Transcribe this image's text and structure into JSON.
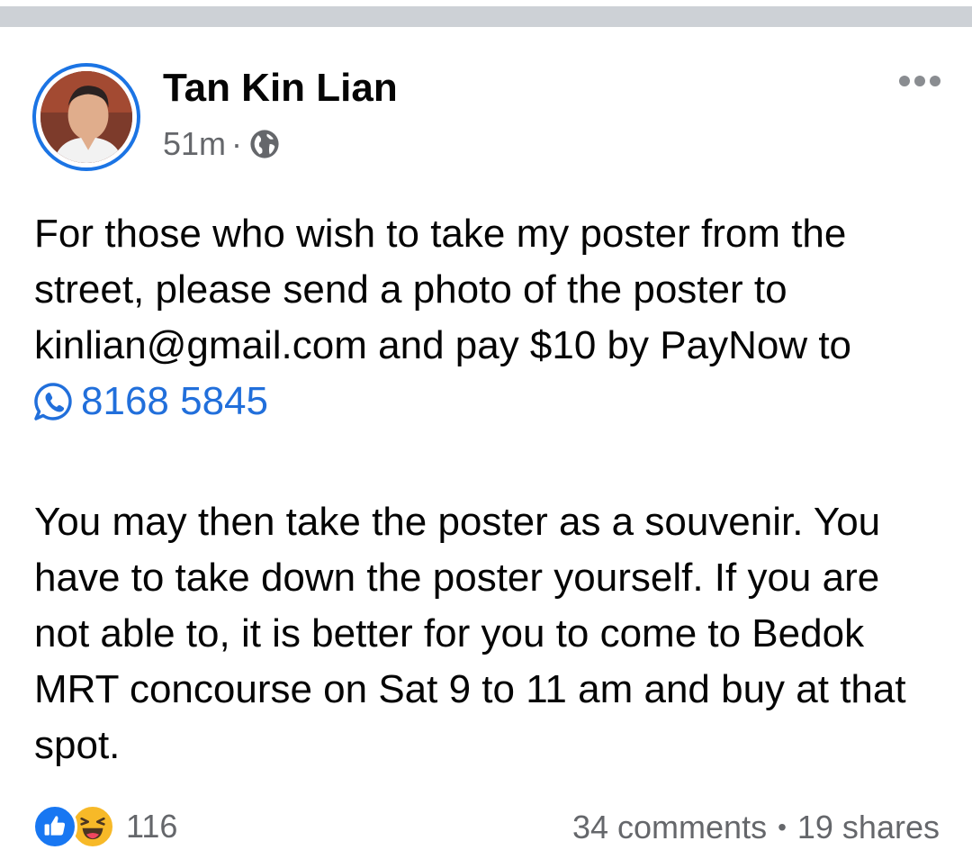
{
  "post": {
    "author": "Tan Kin Lian",
    "time": "51m",
    "meta_separator": "·",
    "privacy_icon": "globe-icon",
    "more_icon": "more-horizontal-icon",
    "paragraph1_before_phone": "For those who wish to take my poster from the street, please send a photo of the poster to kinlian@gmail.com and pay $10 by PayNow to",
    "phone_icon": "whatsapp-icon",
    "phone": "8168 5845",
    "paragraph2": "You may then take the poster as a souvenir. You have to take down the poster yourself. If you are not able to, it is better for you to come to Bedok MRT concourse on Sat 9 to 11 am and buy at that spot."
  },
  "footer": {
    "reaction_icons": [
      "like-icon",
      "haha-icon"
    ],
    "reaction_count": "116",
    "comments": "34 comments",
    "stats_separator": "•",
    "shares": "19 shares"
  },
  "colors": {
    "link": "#216fdb",
    "secondary_text": "#65676b",
    "avatar_ring": "#1b74e4",
    "like": "#1877f2",
    "haha": "#f7b928",
    "divider": "#cdd1d6"
  }
}
